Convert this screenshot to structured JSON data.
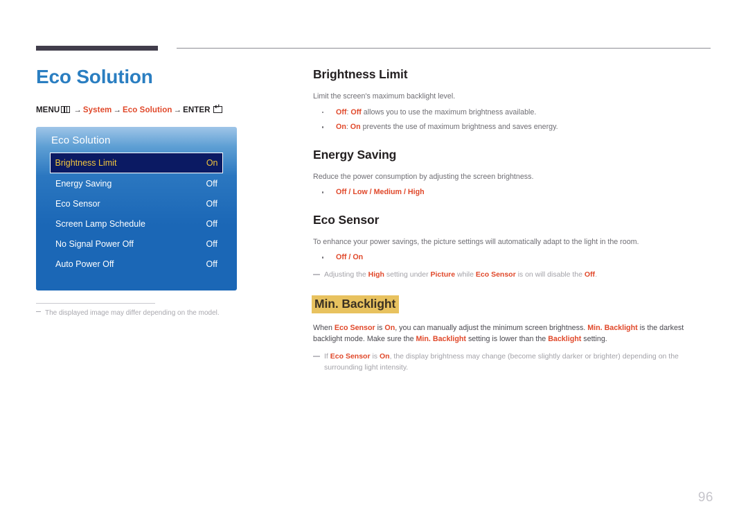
{
  "page": {
    "number": "96",
    "title": "Eco Solution"
  },
  "breadcrumb": {
    "menu_label": "MENU",
    "menu_icon": "menu-grid-icon",
    "arrow": "→",
    "step1": "System",
    "step2": "Eco Solution",
    "enter_label": "ENTER",
    "enter_icon": "enter-key-icon"
  },
  "osd": {
    "title": "Eco Solution",
    "rows": [
      {
        "label": "Brightness Limit",
        "value": "On",
        "selected": true
      },
      {
        "label": "Energy Saving",
        "value": "Off",
        "selected": false
      },
      {
        "label": "Eco Sensor",
        "value": "Off",
        "selected": false
      },
      {
        "label": "Screen Lamp Schedule",
        "value": "Off",
        "selected": false
      },
      {
        "label": "No Signal Power Off",
        "value": "Off",
        "selected": false
      },
      {
        "label": "Auto Power Off",
        "value": "Off",
        "selected": false
      }
    ]
  },
  "left_note": "The displayed image may differ depending on the model.",
  "sections": {
    "brightness_limit": {
      "heading": "Brightness Limit",
      "intro": "Limit the screen's maximum backlight level.",
      "bullet1": {
        "term": "Off",
        "sep": ": ",
        "emph": "Off",
        "rest": " allows you to use the maximum brightness available."
      },
      "bullet2": {
        "term": "On",
        "sep": ": ",
        "emph": "On",
        "rest": " prevents the use of maximum brightness and saves energy."
      }
    },
    "energy_saving": {
      "heading": "Energy Saving",
      "intro": "Reduce the power consumption by adjusting the screen brightness.",
      "options": "Off / Low / Medium / High"
    },
    "eco_sensor": {
      "heading": "Eco Sensor",
      "intro": "To enhance your power savings, the picture settings will automatically adapt to the light in the room.",
      "options": "Off / On",
      "note": {
        "p1": "Adjusting the ",
        "k1": "High",
        "p2": " setting under ",
        "k2": "Picture",
        "p3": " while ",
        "k3": "Eco Sensor",
        "p4": " is on will disable the ",
        "k4": "Off",
        "p5": "."
      }
    },
    "min_backlight": {
      "heading": "Min. Backlight",
      "body": {
        "p1": "When ",
        "k1": "Eco Sensor",
        "p2": " is ",
        "k2": "On",
        "p3": ", you can manually adjust the minimum screen brightness. ",
        "k3": "Min. Backlight",
        "p4": " is the darkest backlight mode. Make sure the ",
        "k4": "Min. Backlight",
        "p5": " setting is lower than the ",
        "k5": "Backlight",
        "p6": " setting."
      },
      "note": {
        "p1": "If ",
        "k1": "Eco Sensor",
        "p2": " is ",
        "k2": "On",
        "p3": ", the display brightness may change (become slightly darker or brighter) depending on the surrounding light intensity."
      }
    }
  },
  "colors": {
    "title_blue": "#2a7ec1",
    "accent_red": "#e0482a",
    "osd_blue": "#1b67b6",
    "osd_selected_bg": "#0b1a63",
    "osd_selected_text": "#f2c53d",
    "highlight_gold": "#e8c25f",
    "rule_dark": "#413d4b"
  }
}
